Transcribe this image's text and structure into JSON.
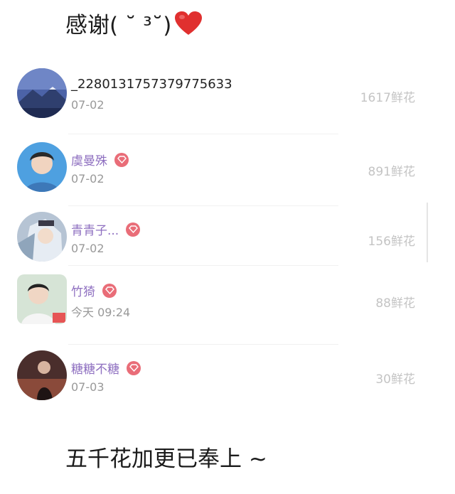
{
  "header": {
    "text": "感谢( ˘ ³˘)"
  },
  "list": {
    "items": [
      {
        "name": "_2280131757379775633",
        "date": "07-02",
        "amount": "1617鲜花",
        "vip": false
      },
      {
        "name": "虞曼殊",
        "date": "07-02",
        "amount": "891鲜花",
        "vip": true
      },
      {
        "name": "青青子...",
        "date": "07-02",
        "amount": "156鲜花",
        "vip": true
      },
      {
        "name": "竹猗",
        "date": "今天 09:24",
        "amount": "88鲜花",
        "vip": true
      },
      {
        "name": "糖糖不糖",
        "date": "07-03",
        "amount": "30鲜花",
        "vip": true
      }
    ]
  },
  "footer": {
    "text": "五千花加更已奉上 ~"
  },
  "colors": {
    "vip_name": "#8e6fc0",
    "badge": "#e96d78",
    "amount": "#c4c4c4",
    "heart": "#e0302f"
  },
  "icons": {
    "heart": "heart-icon",
    "badge": "diamond-badge-icon"
  }
}
